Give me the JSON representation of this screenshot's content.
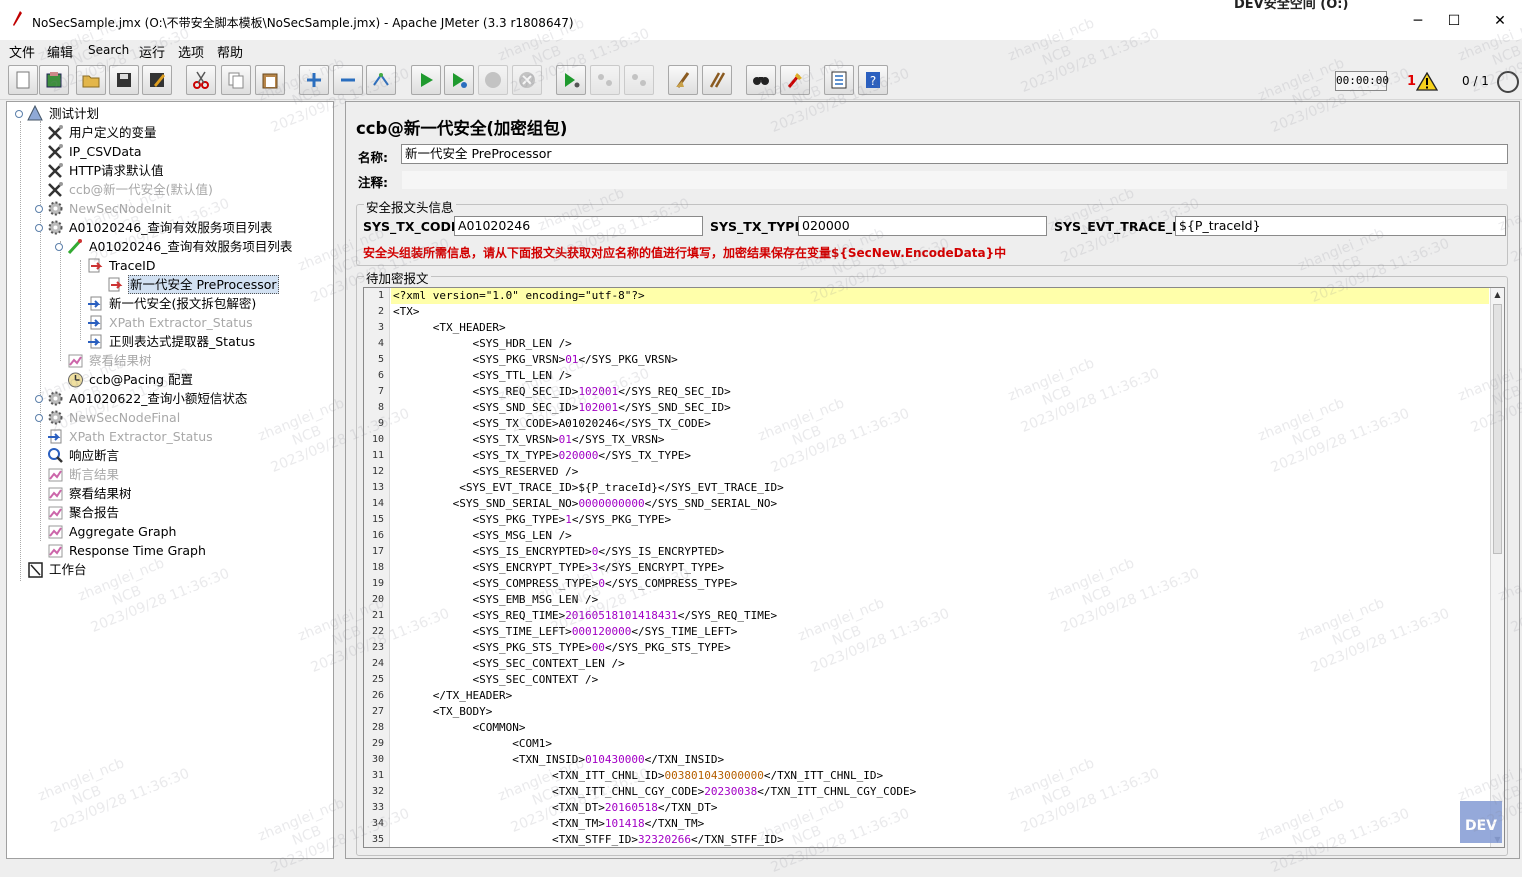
{
  "window": {
    "title": "NoSecSample.jmx (O:\\不带安全脚本模板\\NoSecSample.jmx) - Apache JMeter (3.3 r1808647)",
    "corner_tag": "DEV安全空间 (O:)",
    "minimize": "─",
    "maximize": "☐",
    "close": "✕"
  },
  "menu": [
    "文件",
    "编辑",
    "Search",
    "运行",
    "选项",
    "帮助"
  ],
  "toolbar": [
    {
      "name": "new-icon"
    },
    {
      "name": "templates-icon"
    },
    {
      "name": "open-icon"
    },
    {
      "name": "save-icon"
    },
    {
      "name": "save-as-icon"
    },
    {
      "name": "cut-icon"
    },
    {
      "name": "copy-icon"
    },
    {
      "name": "paste-icon"
    },
    {
      "name": "expand-icon"
    },
    {
      "name": "collapse-icon"
    },
    {
      "name": "toggle-icon"
    },
    {
      "name": "start-icon"
    },
    {
      "name": "start-no-pause-icon"
    },
    {
      "name": "stop-icon"
    },
    {
      "name": "shutdown-icon"
    },
    {
      "name": "remote-start-icon"
    },
    {
      "name": "remote-stop-icon"
    },
    {
      "name": "remote-shutdown-icon"
    },
    {
      "name": "clear-icon"
    },
    {
      "name": "clear-all-icon"
    },
    {
      "name": "search-icon"
    },
    {
      "name": "reset-search-icon"
    },
    {
      "name": "function-helper-icon"
    },
    {
      "name": "help-icon"
    }
  ],
  "status": {
    "timer": "00:00:00",
    "error_count": "1",
    "threads": "0 / 1"
  },
  "tree": [
    {
      "label": "测试计划",
      "icon": "test-plan-icon",
      "dim": false
    },
    {
      "label": "用户定义的变量",
      "icon": "config-icon",
      "dim": false
    },
    {
      "label": "IP_CSVData",
      "icon": "config-icon",
      "dim": false
    },
    {
      "label": "HTTP请求默认值",
      "icon": "config-icon",
      "dim": false
    },
    {
      "label": "ccb@新一代安全(默认值)",
      "icon": "config-icon",
      "dim": true
    },
    {
      "label": "NewSecNodeInit",
      "icon": "thread-group-icon",
      "dim": true
    },
    {
      "label": "A01020246_查询有效服务项目列表",
      "icon": "thread-group-icon",
      "dim": false
    },
    {
      "label": "A01020246_查询有效服务项目列表",
      "icon": "sampler-icon",
      "dim": false
    },
    {
      "label": "TraceID",
      "icon": "preprocessor-icon",
      "dim": false
    },
    {
      "label": "新一代安全  PreProcessor",
      "icon": "preprocessor-icon",
      "dim": false,
      "selected": true
    },
    {
      "label": "新一代安全(报文拆包解密)",
      "icon": "postprocessor-icon",
      "dim": false
    },
    {
      "label": "XPath Extractor_Status",
      "icon": "postprocessor-icon",
      "dim": true
    },
    {
      "label": "正则表达式提取器_Status",
      "icon": "postprocessor-icon",
      "dim": false
    },
    {
      "label": "察看结果树",
      "icon": "listener-icon",
      "dim": true
    },
    {
      "label": "ccb@Pacing 配置",
      "icon": "timer-icon",
      "dim": false
    },
    {
      "label": "A01020622_查询小额短信状态",
      "icon": "thread-group-icon",
      "dim": false
    },
    {
      "label": "NewSecNodeFinal",
      "icon": "thread-group-icon",
      "dim": true
    },
    {
      "label": "XPath Extractor_Status",
      "icon": "postprocessor-icon",
      "dim": true
    },
    {
      "label": "响应断言",
      "icon": "assertion-icon",
      "dim": false
    },
    {
      "label": "断言结果",
      "icon": "listener-icon",
      "dim": true
    },
    {
      "label": "察看结果树",
      "icon": "listener-icon",
      "dim": false
    },
    {
      "label": "聚合报告",
      "icon": "listener-icon",
      "dim": false
    },
    {
      "label": "Aggregate Graph",
      "icon": "listener-icon",
      "dim": false
    },
    {
      "label": "Response Time Graph",
      "icon": "listener-icon",
      "dim": false
    },
    {
      "label": "工作台",
      "icon": "workbench-icon",
      "dim": false
    }
  ],
  "editor": {
    "title": "ccb@新一代安全(加密组包)",
    "name_label": "名称:",
    "name_value": "新一代安全  PreProcessor",
    "comment_label": "注释:",
    "comment_value": "",
    "header_group_title": "安全报文头信息",
    "sys_tx_code_label": "SYS_TX_CODE:",
    "sys_tx_code_value": "A01020246",
    "sys_tx_type_label": "SYS_TX_TYPE:",
    "sys_tx_type_value": "020000",
    "sys_evt_trace_id_label": "SYS_EVT_TRACE_ID:",
    "sys_evt_trace_id_value": "${P_traceId}",
    "warning": "安全头组装所需信息，请从下面报文头获取对应名称的值进行填写，加密结果保存在变量${SecNew.EncodeData}中",
    "body_group_title": "待加密报文"
  },
  "code_lines": [
    [
      [
        "<?xml version=\"1.0\" encoding=\"utf-8\"?>",
        "t"
      ]
    ],
    [
      [
        "<TX>",
        "t"
      ]
    ],
    [
      [
        "      <TX_HEADER>",
        "t"
      ]
    ],
    [
      [
        "            <SYS_HDR_LEN />",
        "t"
      ]
    ],
    [
      [
        "            <SYS_PKG_VRSN>",
        "t"
      ],
      [
        "01",
        "v"
      ],
      [
        "</SYS_PKG_VRSN>",
        "t"
      ]
    ],
    [
      [
        "            <SYS_TTL_LEN />",
        "t"
      ]
    ],
    [
      [
        "            <SYS_REQ_SEC_ID>",
        "t"
      ],
      [
        "102001",
        "v"
      ],
      [
        "</SYS_REQ_SEC_ID>",
        "t"
      ]
    ],
    [
      [
        "            <SYS_SND_SEC_ID>",
        "t"
      ],
      [
        "102001",
        "v"
      ],
      [
        "</SYS_SND_SEC_ID>",
        "t"
      ]
    ],
    [
      [
        "            <SYS_TX_CODE>A01020246</SYS_TX_CODE>",
        "t"
      ]
    ],
    [
      [
        "            <SYS_TX_VRSN>",
        "t"
      ],
      [
        "01",
        "v"
      ],
      [
        "</SYS_TX_VRSN>",
        "t"
      ]
    ],
    [
      [
        "            <SYS_TX_TYPE>",
        "t"
      ],
      [
        "020000",
        "v"
      ],
      [
        "</SYS_TX_TYPE>",
        "t"
      ]
    ],
    [
      [
        "            <SYS_RESERVED />",
        "t"
      ]
    ],
    [
      [
        "          <SYS_EVT_TRACE_ID>${P_traceId}</SYS_EVT_TRACE_ID>",
        "t"
      ]
    ],
    [
      [
        "         <SYS_SND_SERIAL_NO>",
        "t"
      ],
      [
        "0000000000",
        "v"
      ],
      [
        "</SYS_SND_SERIAL_NO>",
        "t"
      ]
    ],
    [
      [
        "            <SYS_PKG_TYPE>",
        "t"
      ],
      [
        "1",
        "v"
      ],
      [
        "</SYS_PKG_TYPE>",
        "t"
      ]
    ],
    [
      [
        "            <SYS_MSG_LEN />",
        "t"
      ]
    ],
    [
      [
        "            <SYS_IS_ENCRYPTED>",
        "t"
      ],
      [
        "0",
        "v"
      ],
      [
        "</SYS_IS_ENCRYPTED>",
        "t"
      ]
    ],
    [
      [
        "            <SYS_ENCRYPT_TYPE>",
        "t"
      ],
      [
        "3",
        "v"
      ],
      [
        "</SYS_ENCRYPT_TYPE>",
        "t"
      ]
    ],
    [
      [
        "            <SYS_COMPRESS_TYPE>",
        "t"
      ],
      [
        "0",
        "v"
      ],
      [
        "</SYS_COMPRESS_TYPE>",
        "t"
      ]
    ],
    [
      [
        "            <SYS_EMB_MSG_LEN />",
        "t"
      ]
    ],
    [
      [
        "            <SYS_REQ_TIME>",
        "t"
      ],
      [
        "20160518101418431",
        "v"
      ],
      [
        "</SYS_REQ_TIME>",
        "t"
      ]
    ],
    [
      [
        "            <SYS_TIME_LEFT>",
        "t"
      ],
      [
        "000120000",
        "v"
      ],
      [
        "</SYS_TIME_LEFT>",
        "t"
      ]
    ],
    [
      [
        "            <SYS_PKG_STS_TYPE>",
        "t"
      ],
      [
        "00",
        "v"
      ],
      [
        "</SYS_PKG_STS_TYPE>",
        "t"
      ]
    ],
    [
      [
        "            <SYS_SEC_CONTEXT_LEN />",
        "t"
      ]
    ],
    [
      [
        "            <SYS_SEC_CONTEXT />",
        "t"
      ]
    ],
    [
      [
        "      </TX_HEADER>",
        "t"
      ]
    ],
    [
      [
        "      <TX_BODY>",
        "t"
      ]
    ],
    [
      [
        "            <COMMON>",
        "t"
      ]
    ],
    [
      [
        "                  <COM1>",
        "t"
      ]
    ],
    [
      [
        "                  <TXN_INSID>",
        "t"
      ],
      [
        "010430000",
        "v"
      ],
      [
        "</TXN_INSID>",
        "t"
      ]
    ],
    [
      [
        "                        <TXN_ITT_CHNL_ID>",
        "t"
      ],
      [
        "003801043000000",
        "s"
      ],
      [
        "</TXN_ITT_CHNL_ID>",
        "t"
      ]
    ],
    [
      [
        "                        <TXN_ITT_CHNL_CGY_CODE>",
        "t"
      ],
      [
        "20230038",
        "v"
      ],
      [
        "</TXN_ITT_CHNL_CGY_CODE>",
        "t"
      ]
    ],
    [
      [
        "                        <TXN_DT>",
        "t"
      ],
      [
        "20160518",
        "v"
      ],
      [
        "</TXN_DT>",
        "t"
      ]
    ],
    [
      [
        "                        <TXN_TM>",
        "t"
      ],
      [
        "101418",
        "v"
      ],
      [
        "</TXN_TM>",
        "t"
      ]
    ],
    [
      [
        "                        <TXN_STFF_ID>",
        "t"
      ],
      [
        "32320266",
        "v"
      ],
      [
        "</TXN_STFF_ID>",
        "t"
      ]
    ]
  ],
  "watermark": {
    "user": "zhanglei_ncb",
    "org": "NCB",
    "time": "2023/09/28 11:36:30"
  },
  "badge": "DEV"
}
